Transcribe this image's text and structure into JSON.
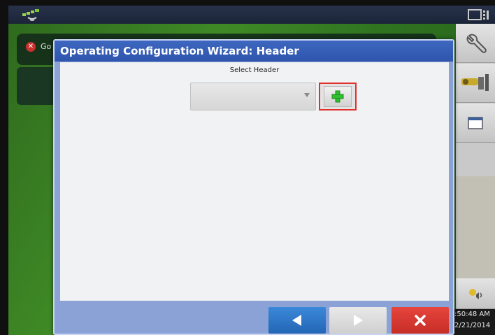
{
  "topbar": {
    "gps_icon": "satellite-icon",
    "display_icon": "display-settings-icon"
  },
  "background": {
    "error_icon": "error-icon",
    "status_text": "Go"
  },
  "sidebar": {
    "tools_icon": "wrench-icon",
    "setup_icon": "vehicle-setup-icon",
    "window_icon": "window-icon",
    "volume_icon": "volume-icon",
    "time": ":50:48 AM",
    "date": "2/21/2014"
  },
  "dialog": {
    "title": "Operating Configuration Wizard:  Header",
    "select_label": "Select Header",
    "header_select_value": "",
    "add_button_icon": "plus-icon",
    "back_icon": "left-arrow-icon",
    "next_icon": "right-arrow-icon",
    "cancel_icon": "close-icon"
  },
  "colors": {
    "title_bar": "#3d67c0",
    "dialog_frame": "#8aa2d6",
    "back_button": "#2d75c8",
    "cancel_button": "#d63a33",
    "add_highlight": "#e2302d",
    "plus_green": "#2fbf2f",
    "background_green": "#3f8a26"
  }
}
